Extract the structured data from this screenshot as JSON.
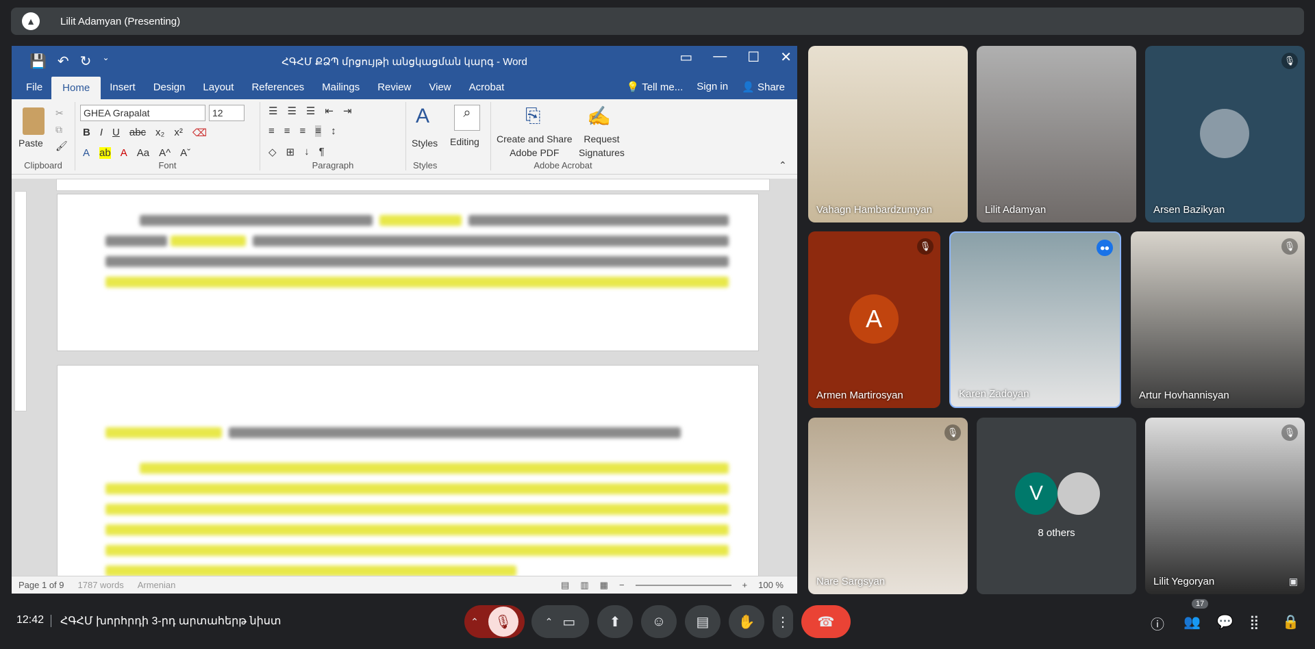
{
  "presenting_bar": {
    "text": "Lilit Adamyan (Presenting)"
  },
  "word": {
    "doc_title": "ՀԳՀՄ ՔՁՊ մրցույթի անցկացման կարգ - Word",
    "menus": [
      "File",
      "Home",
      "Insert",
      "Design",
      "Layout",
      "References",
      "Mailings",
      "Review",
      "View",
      "Acrobat"
    ],
    "tell_me": "Tell me...",
    "sign_in": "Sign in",
    "share": "Share",
    "ribbon": {
      "paste": "Paste",
      "clipboard": "Clipboard",
      "font_name": "GHEA Grapalat",
      "font_size": "12",
      "font": "Font",
      "paragraph": "Paragraph",
      "styles": "Styles",
      "styles_group": "Styles",
      "editing": "Editing",
      "create_share_1": "Create and Share",
      "create_share_2": "Adobe PDF",
      "request_1": "Request",
      "request_2": "Signatures",
      "adobe_acrobat": "Adobe Acrobat"
    },
    "status": {
      "page": "Page 1 of 9",
      "words": "1787 words",
      "lang": "Armenian",
      "zoom": "100 %"
    }
  },
  "participants": [
    {
      "name": "Vahagn Hambardzumyan",
      "muted": false
    },
    {
      "name": "Lilit Adamyan",
      "muted": false
    },
    {
      "name": "Arsen Bazikyan",
      "muted": true
    },
    {
      "name": "Armen Martirosyan",
      "muted": true,
      "initial": "A",
      "avatar_color": "#c1440e"
    },
    {
      "name": "Karen Zadoyan",
      "muted": false,
      "speaking": true
    },
    {
      "name": "Artur Hovhannisyan",
      "muted": true
    },
    {
      "name": "Nare Sargsyan",
      "muted": true
    },
    {
      "name": "8 others",
      "initial": "V",
      "avatar_color": "#00796b"
    },
    {
      "name": "Lilit Yegoryan",
      "muted": true
    }
  ],
  "bottom": {
    "time": "12:42",
    "meeting_title": "ՀԳՀՄ խորհրդի 3-րդ արտահերթ նիստ",
    "participants_count": "17"
  },
  "colors": {
    "word_blue": "#2b579a",
    "end_call": "#ea4335",
    "meet_bg": "#202124"
  }
}
